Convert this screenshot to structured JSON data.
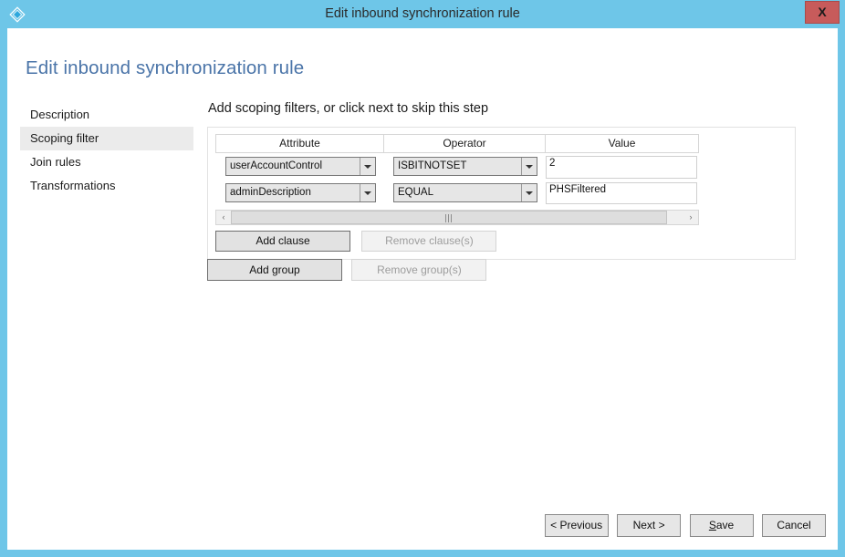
{
  "window": {
    "title": "Edit inbound synchronization rule",
    "icon": "azure-diamond-icon",
    "close_label": "X",
    "frame_color": "#6ec6e8",
    "close_color": "#c75b5b"
  },
  "page": {
    "heading": "Edit inbound synchronization rule",
    "heading_color": "#4a74a8"
  },
  "sidebar": {
    "items": [
      {
        "label": "Description",
        "selected": false
      },
      {
        "label": "Scoping filter",
        "selected": true
      },
      {
        "label": "Join rules",
        "selected": false
      },
      {
        "label": "Transformations",
        "selected": false
      }
    ]
  },
  "main": {
    "heading": "Add scoping filters, or click next to skip this step",
    "grid": {
      "columns": [
        "Attribute",
        "Operator",
        "Value"
      ],
      "rows": [
        {
          "attribute": "userAccountControl",
          "operator": "ISBITNOTSET",
          "value": "2"
        },
        {
          "attribute": "adminDescription",
          "operator": "EQUAL",
          "value": "PHSFiltered"
        }
      ]
    },
    "scrollbar": {
      "left_arrow": "‹",
      "right_arrow": "›",
      "grip": "III"
    },
    "clause_buttons": {
      "add_label": "Add clause",
      "remove_label": "Remove clause(s)",
      "remove_enabled": false
    },
    "group_buttons": {
      "add_label": "Add group",
      "remove_label": "Remove group(s)",
      "remove_enabled": false
    }
  },
  "footer": {
    "previous_label": "< Previous",
    "next_label": "Next >",
    "save_label_accel": "S",
    "save_label_rest": "ave",
    "cancel_label": "Cancel"
  }
}
